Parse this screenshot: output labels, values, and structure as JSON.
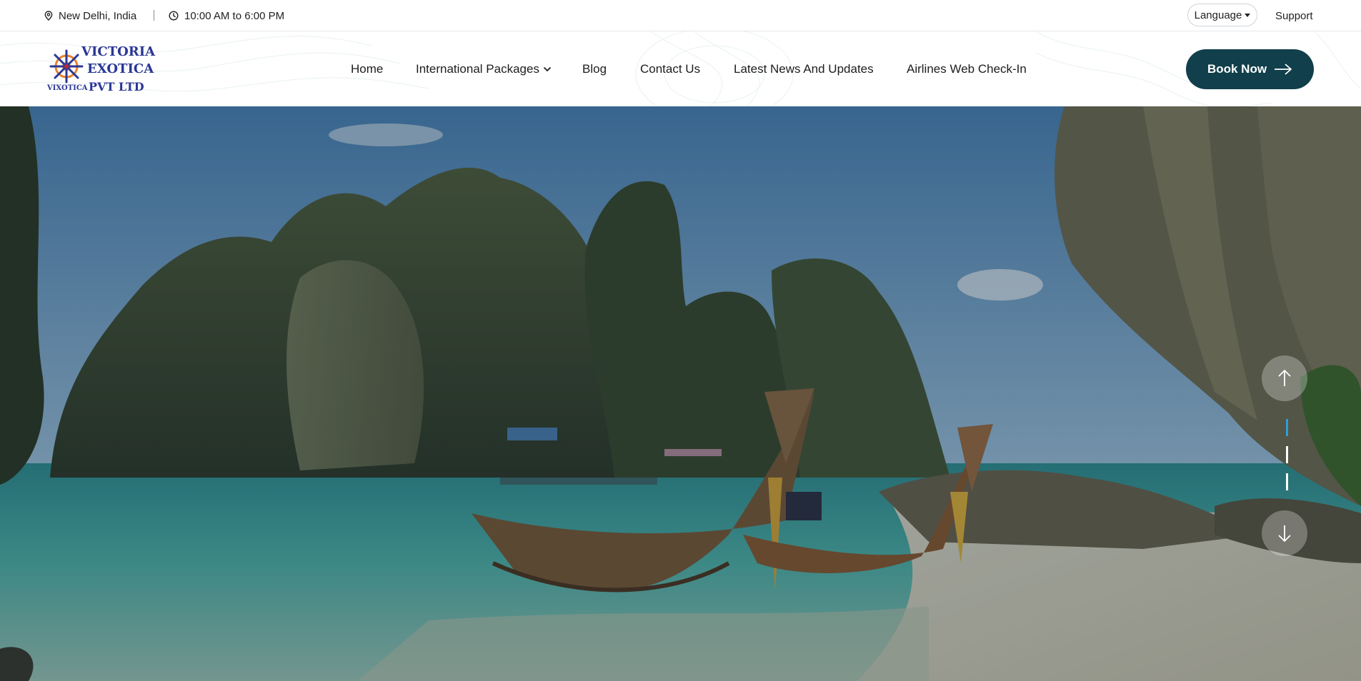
{
  "topbar": {
    "location": "New Delhi, India",
    "hours": "10:00 AM to 6:00 PM",
    "language_label": "Language",
    "support_label": "Support",
    "location_icon": "map-pin-icon",
    "clock_icon": "clock-icon"
  },
  "brand": {
    "line1": "VICTORIA",
    "line2": "EXOTICA",
    "line3": "PVT LTD",
    "tag": "VIXOTICA",
    "color": "#2b3795"
  },
  "nav": {
    "items": [
      {
        "label": "Home"
      },
      {
        "label": "International Packages",
        "has_dropdown": true
      },
      {
        "label": "Blog"
      },
      {
        "label": "Contact Us"
      },
      {
        "label": "Latest News And Updates"
      },
      {
        "label": "Airlines Web Check-In"
      }
    ],
    "cta_label": "Book Now",
    "cta_color": "#113f4b"
  },
  "hero": {
    "slides_total": 3,
    "active_slide": 1,
    "accent": "#2f9ed6"
  }
}
